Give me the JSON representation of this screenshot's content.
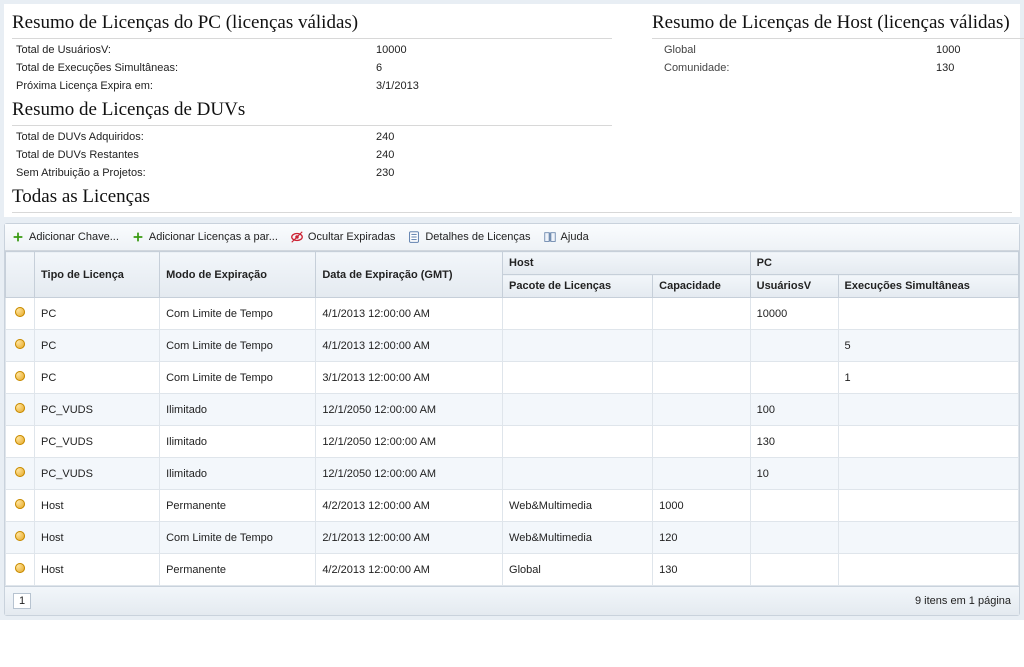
{
  "pc_summary": {
    "title": "Resumo de Licenças do PC (licenças válidas)",
    "rows": [
      {
        "k": "Total de UsuáriosV:",
        "v": "10000"
      },
      {
        "k": "Total de Execuções Simultâneas:",
        "v": "6"
      },
      {
        "k": "Próxima Licença Expira em:",
        "v": "3/1/2013"
      }
    ]
  },
  "duv_summary": {
    "title": "Resumo de Licenças de DUVs",
    "rows": [
      {
        "k": "Total de DUVs Adquiridos:",
        "v": "240"
      },
      {
        "k": "Total de DUVs Restantes",
        "v": "240"
      },
      {
        "k": "Sem Atribuição a Projetos:",
        "v": "230"
      }
    ]
  },
  "host_summary": {
    "title": "Resumo de Licenças de Host (licenças válidas)",
    "rows": [
      {
        "k": "Global",
        "v": "1000"
      },
      {
        "k": "Comunidade:",
        "v": "130"
      }
    ]
  },
  "all_title": "Todas as Licenças",
  "toolbar": {
    "add_key": "Adicionar Chave...",
    "add_to": "Adicionar Licenças a par...",
    "hide_expired": "Ocultar Expiradas",
    "details": "Detalhes de Licenças",
    "help": "Ajuda"
  },
  "headers": {
    "tipo": "Tipo de Licença",
    "modo": "Modo de Expiração",
    "data": "Data de Expiração (GMT)",
    "host_group": "Host",
    "pc_group": "PC",
    "pacote": "Pacote de Licenças",
    "capacidade": "Capacidade",
    "usuarios": "UsuáriosV",
    "exec": "Execuções Simultâneas"
  },
  "rows": [
    {
      "tipo": "PC",
      "modo": "Com Limite de Tempo",
      "data": "4/1/2013 12:00:00 AM",
      "pacote": "",
      "cap": "",
      "usr": "10000",
      "exec": ""
    },
    {
      "tipo": "PC",
      "modo": "Com Limite de Tempo",
      "data": "4/1/2013 12:00:00 AM",
      "pacote": "",
      "cap": "",
      "usr": "",
      "exec": "5"
    },
    {
      "tipo": "PC",
      "modo": "Com Limite de Tempo",
      "data": "3/1/2013 12:00:00 AM",
      "pacote": "",
      "cap": "",
      "usr": "",
      "exec": "1"
    },
    {
      "tipo": "PC_VUDS",
      "modo": "Ilimitado",
      "data": "12/1/2050 12:00:00 AM",
      "pacote": "",
      "cap": "",
      "usr": "100",
      "exec": ""
    },
    {
      "tipo": "PC_VUDS",
      "modo": "Ilimitado",
      "data": "12/1/2050 12:00:00 AM",
      "pacote": "",
      "cap": "",
      "usr": "130",
      "exec": ""
    },
    {
      "tipo": "PC_VUDS",
      "modo": "Ilimitado",
      "data": "12/1/2050 12:00:00 AM",
      "pacote": "",
      "cap": "",
      "usr": "10",
      "exec": ""
    },
    {
      "tipo": "Host",
      "modo": "Permanente",
      "data": "4/2/2013 12:00:00 AM",
      "pacote": "Web&Multimedia",
      "cap": "1000",
      "usr": "",
      "exec": ""
    },
    {
      "tipo": "Host",
      "modo": "Com Limite de Tempo",
      "data": "2/1/2013 12:00:00 AM",
      "pacote": "Web&Multimedia",
      "cap": "120",
      "usr": "",
      "exec": ""
    },
    {
      "tipo": "Host",
      "modo": "Permanente",
      "data": "4/2/2013 12:00:00 AM",
      "pacote": "Global",
      "cap": "130",
      "usr": "",
      "exec": ""
    }
  ],
  "pager": {
    "page": "1",
    "status": "9 itens em 1 página"
  }
}
